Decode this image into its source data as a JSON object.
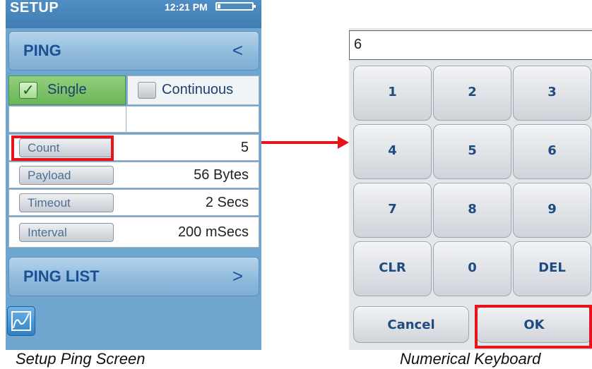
{
  "device": {
    "status": {
      "title": "SETUP",
      "time": "12:21 PM"
    },
    "ping_header": {
      "label": "PING",
      "chevron": "<"
    },
    "mode": {
      "single": "Single",
      "single_check": "✓",
      "continuous": "Continuous",
      "selected": "Single"
    },
    "params": [
      {
        "label": "Count",
        "value": "5"
      },
      {
        "label": "Payload",
        "value": "56 Bytes"
      },
      {
        "label": "Timeout",
        "value": "2 Secs"
      },
      {
        "label": "Interval",
        "value": "200 mSecs"
      }
    ],
    "ping_list_header": {
      "label": "PING LIST",
      "chevron": ">"
    },
    "graph_button_icon": "graph-icon"
  },
  "keyboard": {
    "input_value": "6",
    "rows": [
      [
        "1",
        "2",
        "3"
      ],
      [
        "4",
        "5",
        "6"
      ],
      [
        "7",
        "8",
        "9"
      ],
      [
        "CLR",
        "0",
        "DEL"
      ]
    ],
    "cancel": "Cancel",
    "ok": "OK"
  },
  "captions": {
    "left": "Setup Ping Screen",
    "right": "Numerical Keyboard"
  },
  "colors": {
    "highlight": "#e8141c",
    "selected_green": "#6bb55a",
    "header_text": "#1c4f93"
  }
}
